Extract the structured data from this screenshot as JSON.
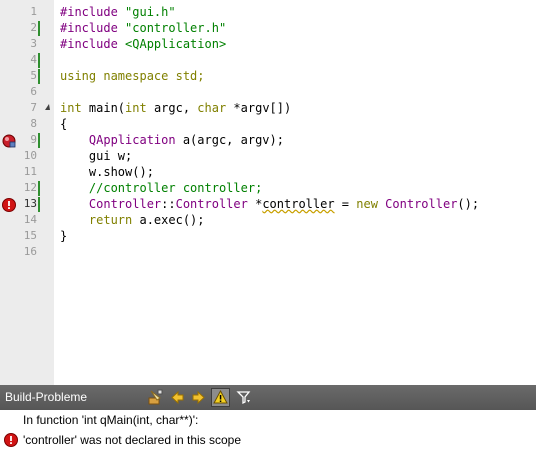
{
  "editor": {
    "lines": [
      {
        "num": "1",
        "mod": false,
        "marker": "",
        "parts": [
          {
            "t": "#include ",
            "c": "cls"
          },
          {
            "t": "\"gui.h\"",
            "c": "str"
          }
        ]
      },
      {
        "num": "2",
        "mod": true,
        "marker": "",
        "parts": [
          {
            "t": "#include ",
            "c": "cls"
          },
          {
            "t": "\"controller.h\"",
            "c": "str"
          }
        ]
      },
      {
        "num": "3",
        "mod": false,
        "marker": "",
        "parts": [
          {
            "t": "#include ",
            "c": "cls"
          },
          {
            "t": "<QApplication>",
            "c": "str"
          }
        ]
      },
      {
        "num": "4",
        "mod": true,
        "marker": "",
        "parts": []
      },
      {
        "num": "5",
        "mod": true,
        "marker": "",
        "parts": [
          {
            "t": "using namespace std;",
            "c": "kw"
          }
        ]
      },
      {
        "num": "6",
        "mod": false,
        "marker": "",
        "parts": []
      },
      {
        "num": "7",
        "mod": false,
        "marker": "",
        "fold": true,
        "parts": [
          {
            "t": "int ",
            "c": "kw"
          },
          {
            "t": "main(",
            "c": ""
          },
          {
            "t": "int ",
            "c": "kw"
          },
          {
            "t": "argc, ",
            "c": ""
          },
          {
            "t": "char ",
            "c": "kw"
          },
          {
            "t": "*argv[])",
            "c": ""
          }
        ]
      },
      {
        "num": "8",
        "mod": false,
        "marker": "",
        "parts": [
          {
            "t": "{",
            "c": ""
          }
        ]
      },
      {
        "num": "9",
        "mod": true,
        "marker": "breakpoint",
        "parts": [
          {
            "t": "    ",
            "c": ""
          },
          {
            "t": "QApplication ",
            "c": "cls"
          },
          {
            "t": "a(argc, argv);",
            "c": ""
          }
        ]
      },
      {
        "num": "10",
        "mod": false,
        "marker": "",
        "parts": [
          {
            "t": "    gui w;",
            "c": ""
          }
        ]
      },
      {
        "num": "11",
        "mod": false,
        "marker": "",
        "parts": [
          {
            "t": "    w.show();",
            "c": ""
          }
        ]
      },
      {
        "num": "12",
        "mod": true,
        "marker": "",
        "parts": [
          {
            "t": "    ",
            "c": ""
          },
          {
            "t": "//controller controller;",
            "c": "cmt"
          }
        ]
      },
      {
        "num": "13",
        "mod": true,
        "marker": "error",
        "current": true,
        "parts": [
          {
            "t": "    ",
            "c": ""
          },
          {
            "t": "Controller",
            "c": "cls"
          },
          {
            "t": "::",
            "c": ""
          },
          {
            "t": "Controller ",
            "c": "cls"
          },
          {
            "t": "*",
            "c": ""
          },
          {
            "t": "controller",
            "c": "err"
          },
          {
            "t": " = ",
            "c": ""
          },
          {
            "t": "new ",
            "c": "kw"
          },
          {
            "t": "Controller",
            "c": "cls"
          },
          {
            "t": "();",
            "c": ""
          }
        ]
      },
      {
        "num": "14",
        "mod": false,
        "marker": "",
        "parts": [
          {
            "t": "    ",
            "c": ""
          },
          {
            "t": "return ",
            "c": "kw"
          },
          {
            "t": "a.exec();",
            "c": ""
          }
        ]
      },
      {
        "num": "15",
        "mod": false,
        "marker": "",
        "parts": [
          {
            "t": "}",
            "c": ""
          }
        ]
      },
      {
        "num": "16",
        "mod": false,
        "marker": "",
        "parts": []
      }
    ]
  },
  "build_panel": {
    "title": "Build-Probleme",
    "toolbar_icons": [
      "build-icon",
      "arrow-left-icon",
      "arrow-right-icon",
      "warning-filter-icon",
      "funnel-icon"
    ],
    "issues": [
      {
        "icon": "",
        "text": "In function 'int qMain(int, char**)':"
      },
      {
        "icon": "error-icon",
        "text": "'controller' was not declared in this scope"
      }
    ]
  }
}
